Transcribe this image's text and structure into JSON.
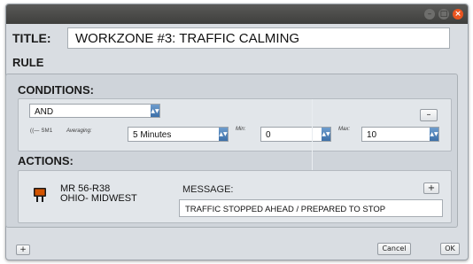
{
  "window": {
    "min_icon": "–",
    "max_icon": "□",
    "close_icon": "×"
  },
  "title": {
    "label": "TITLE:",
    "value": "WORKZONE #3: TRAFFIC CALMING"
  },
  "rule": {
    "label": "RULE"
  },
  "conditions": {
    "label": "CONDITIONS:",
    "operator": "AND",
    "remove_label": "–",
    "sensor": "((— SM1",
    "averaging_label": "Averaging:",
    "averaging_value": "5 Minutes",
    "min_label": "Min:",
    "min_value": "0",
    "max_label": "Max:",
    "max_value": "10"
  },
  "actions": {
    "label": "ACTIONS:",
    "sign_line1": "MR 56-R38",
    "sign_line2": "OHIO- MIDWEST",
    "message_label": "MESSAGE:",
    "message_value": "TRAFFIC STOPPED AHEAD / PREPARED TO STOP",
    "add_label": "+"
  },
  "footer": {
    "add_label": "+",
    "cancel_label": "Cancel",
    "ok_label": "OK"
  },
  "colors": {
    "titlebar": "#3e3e3c",
    "close": "#e95420",
    "select_arrow": "#3c6fa8",
    "panel": "#cfd4da"
  }
}
